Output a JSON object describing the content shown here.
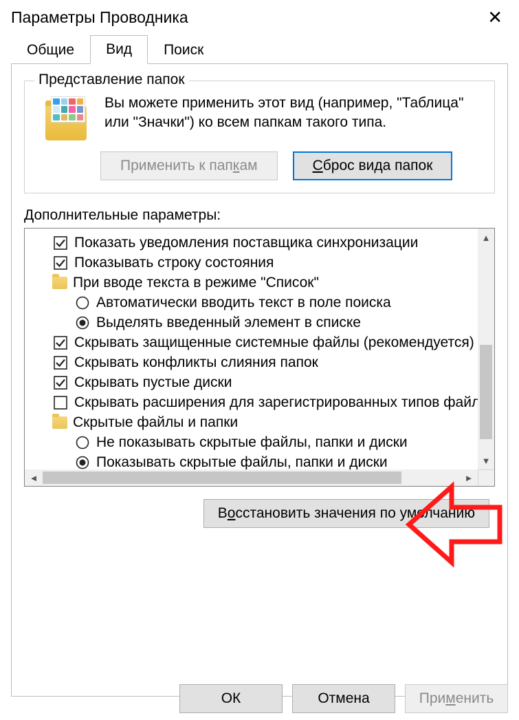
{
  "window": {
    "title": "Параметры Проводника"
  },
  "tabs": {
    "general": "Общие",
    "view": "Вид",
    "search": "Поиск"
  },
  "folder_views": {
    "legend": "Представление папок",
    "description": "Вы можете применить этот вид (например, \"Таблица\" или \"Значки\") ко всем папкам такого типа.",
    "apply_label_pre": "Применить к пап",
    "apply_label_u": "к",
    "apply_label_post": "ам",
    "reset_label_u": "С",
    "reset_label_post": "брос вида папок"
  },
  "advanced": {
    "label": "Дополнительные параметры:",
    "items": [
      {
        "type": "checkbox",
        "checked": true,
        "indent": 1,
        "label": "Показать уведомления поставщика синхронизации"
      },
      {
        "type": "checkbox",
        "checked": true,
        "indent": 1,
        "label": "Показывать строку состояния"
      },
      {
        "type": "folder",
        "indent": 1,
        "label": "При вводе текста в режиме \"Список\""
      },
      {
        "type": "radio",
        "checked": false,
        "indent": 2,
        "label": "Автоматически вводить текст в поле поиска"
      },
      {
        "type": "radio",
        "checked": true,
        "indent": 2,
        "label": "Выделять введенный элемент в списке"
      },
      {
        "type": "checkbox",
        "checked": true,
        "indent": 1,
        "label": "Скрывать защищенные системные файлы (рекомендуется)"
      },
      {
        "type": "checkbox",
        "checked": true,
        "indent": 1,
        "label": "Скрывать конфликты слияния папок"
      },
      {
        "type": "checkbox",
        "checked": true,
        "indent": 1,
        "label": "Скрывать пустые диски"
      },
      {
        "type": "checkbox",
        "checked": false,
        "indent": 1,
        "label": "Скрывать расширения для зарегистрированных типов файлов"
      },
      {
        "type": "folder",
        "indent": 1,
        "label": "Скрытые файлы и папки"
      },
      {
        "type": "radio",
        "checked": false,
        "indent": 2,
        "label": "Не показывать скрытые файлы, папки и диски"
      },
      {
        "type": "radio",
        "checked": true,
        "indent": 2,
        "label": "Показывать скрытые файлы, папки и диски"
      }
    ]
  },
  "restore": {
    "pre": "В",
    "u": "о",
    "post": "сстановить значения по умолчанию"
  },
  "footer": {
    "ok": "ОК",
    "cancel": "Отмена",
    "apply_pre": "При",
    "apply_u": "м",
    "apply_post": "енить"
  }
}
